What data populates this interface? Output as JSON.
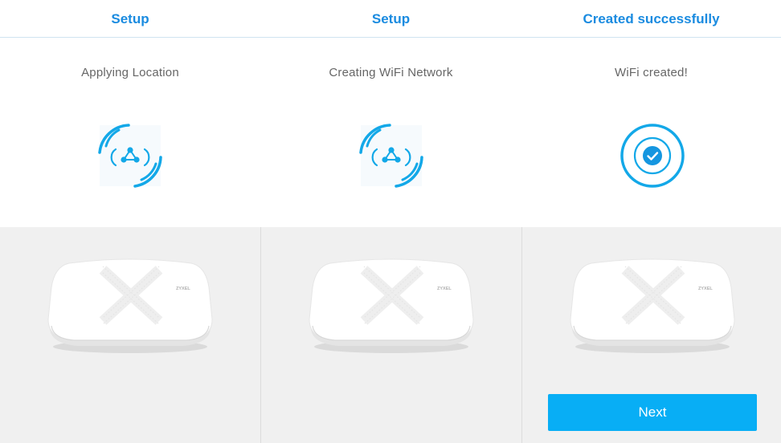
{
  "header": {
    "columns": [
      {
        "label": "Setup"
      },
      {
        "label": "Setup"
      },
      {
        "label": "Created successfully"
      }
    ]
  },
  "steps": [
    {
      "status": "Applying Location",
      "icon": "network-progress-icon"
    },
    {
      "status": "Creating WiFi Network",
      "icon": "network-progress-icon"
    },
    {
      "status": "WiFi created!",
      "icon": "check-circle-icon"
    }
  ],
  "device": {
    "brand": "ZYXEL"
  },
  "actions": {
    "next_label": "Next"
  },
  "colors": {
    "accent": "#1a8be0",
    "icon_blue": "#13a8e8",
    "button": "#08aef5",
    "panel_bg": "#f0f0f0"
  }
}
